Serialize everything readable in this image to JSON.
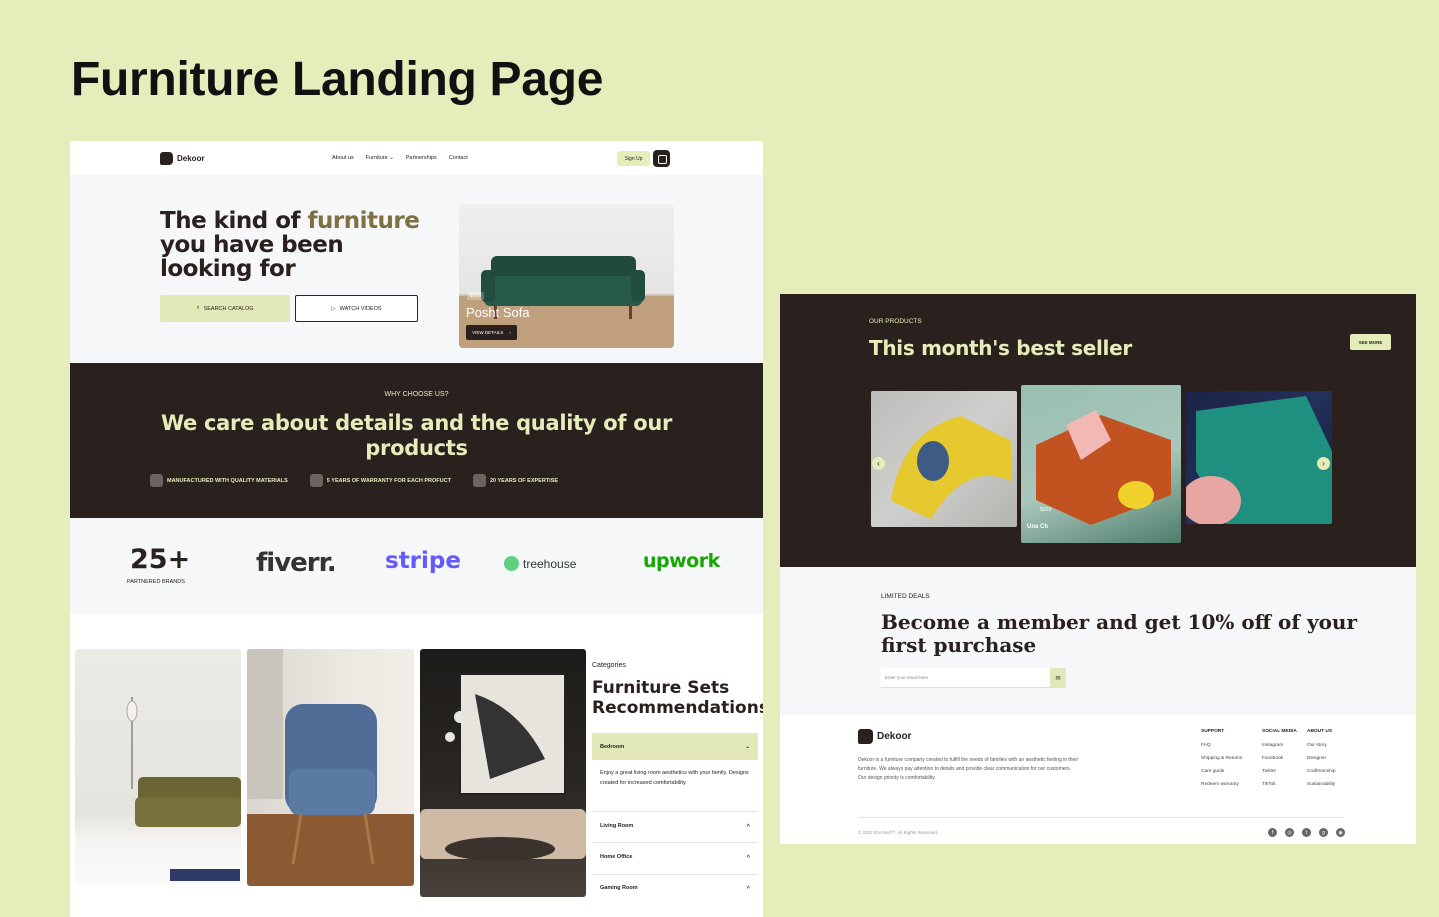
{
  "page": {
    "heading": "Furniture Landing Page"
  },
  "nav": {
    "logo": "Dekoor",
    "links": [
      "About us",
      "Furniture",
      "Partnerships",
      "Contact"
    ],
    "signup": "Sign Up"
  },
  "hero": {
    "title_part1": "The kind of ",
    "title_accent": "furniture",
    "title_part2": " you have been looking for",
    "search_btn": "SEARCH CATALOG",
    "watch_btn": "WATCH VIDEOS",
    "product": {
      "price": "$329",
      "name": "Posht Sofa",
      "btn": "VIEW DETAILS"
    }
  },
  "why": {
    "eyebrow": "WHY CHOOSE US?",
    "title": "We care about details and the quality of our products",
    "features": [
      "MANUFACTURED WITH QUALITY MATERIALS",
      "5 YEARS OF WARRANTY FOR EACH PROFUCT",
      "20 YEARS OF EXPERTISE"
    ]
  },
  "brands": {
    "stat": "25+",
    "stat_label": "PARTNERED BRANDS",
    "names": [
      "fiverr.",
      "stripe",
      "treehouse",
      "upwork"
    ]
  },
  "categories": {
    "eyebrow": "Categories",
    "title": "Furniture Sets Recommendations",
    "items": [
      {
        "label": "Bedroom",
        "desc": "Enjoy a great living room aesthetics with your family. Designs created for increased comfortability."
      },
      {
        "label": "Living Room"
      },
      {
        "label": "Home Office"
      },
      {
        "label": "Gaming Room"
      }
    ]
  },
  "best_seller": {
    "eyebrow": "OUR PRODUCTS",
    "title": "This month's best seller",
    "see_more": "SEE MORE",
    "featured_price": "$329",
    "featured_name": "Una Ch"
  },
  "deals": {
    "eyebrow": "LIMITED DEALS",
    "title": "Become a member and get 10% off of your first purchase",
    "email_placeholder": "Enter your email here"
  },
  "footer": {
    "logo": "Dekoor",
    "desc": "Dekoor is a furniture company created to fulfill the needs of families with an aesthetic feeling in their furniture. We always pay attention to details and provide clear communication for our customers. Our design priority is comfortability.",
    "columns": [
      {
        "head": "SUPPORT",
        "items": [
          "FAQ",
          "Shipping & Returns",
          "Care guide",
          "Redeem warranty"
        ]
      },
      {
        "head": "SOCIAL MEDIA",
        "items": [
          "Instagram",
          "Facebook",
          "Twitter",
          "TikTok"
        ]
      },
      {
        "head": "ABOUT US",
        "items": [
          "Our story",
          "Designer",
          "Craftmanship",
          "Sustainability"
        ]
      }
    ],
    "copyright": "© 2022 Erin Bell™. All Rights Reserved.",
    "social_icons": [
      "facebook-icon",
      "instagram-icon",
      "twitter-icon",
      "github-icon",
      "dribbble-icon"
    ]
  },
  "colors": {
    "background": "#e5eebb",
    "dark": "#2a211e",
    "accent": "#7e7042",
    "light": "#f6f7f9"
  }
}
